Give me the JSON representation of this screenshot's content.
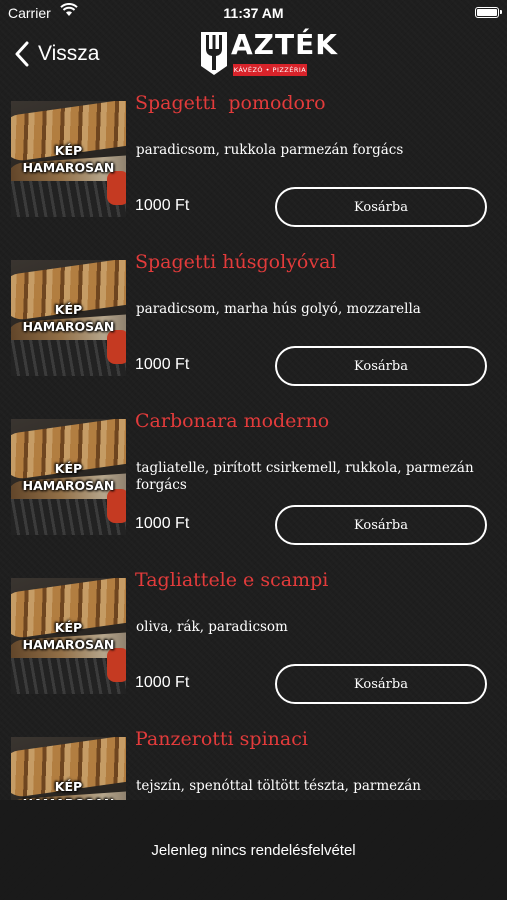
{
  "status_bar": {
    "carrier": "Carrier",
    "time": "11:37 AM"
  },
  "nav": {
    "back_label": "Vissza",
    "logo_text": "AZTÉK",
    "logo_sub": "KÁVÉZÓ • PIZZÉRIA"
  },
  "thumb_placeholder": {
    "line1": "KÉP",
    "line2": "HAMAROSAN"
  },
  "cart_label": "Kosárba",
  "items": [
    {
      "name": "Spagetti  pomodoro",
      "desc": "paradicsom, rukkola parmezán forgács",
      "price": "1000 Ft"
    },
    {
      "name": "Spagetti húsgolyóval",
      "desc": "paradicsom, marha hús golyó, mozzarella",
      "price": "1000 Ft"
    },
    {
      "name": "Carbonara moderno",
      "desc": "tagliatelle, pirított csirkemell, rukkola, parmezán forgács",
      "price": "1000 Ft"
    },
    {
      "name": "Tagliattele e scampi",
      "desc": "oliva, rák, paradicsom",
      "price": "1000 Ft"
    },
    {
      "name": "Panzerotti spinaci",
      "desc": "tejszín, spenóttal töltött tészta, parmezán",
      "price": ""
    }
  ],
  "footer": {
    "message": "Jelenleg nincs rendelésfelvétel"
  },
  "colors": {
    "accent_red": "#e23b3b",
    "background": "#1e1e1e"
  }
}
